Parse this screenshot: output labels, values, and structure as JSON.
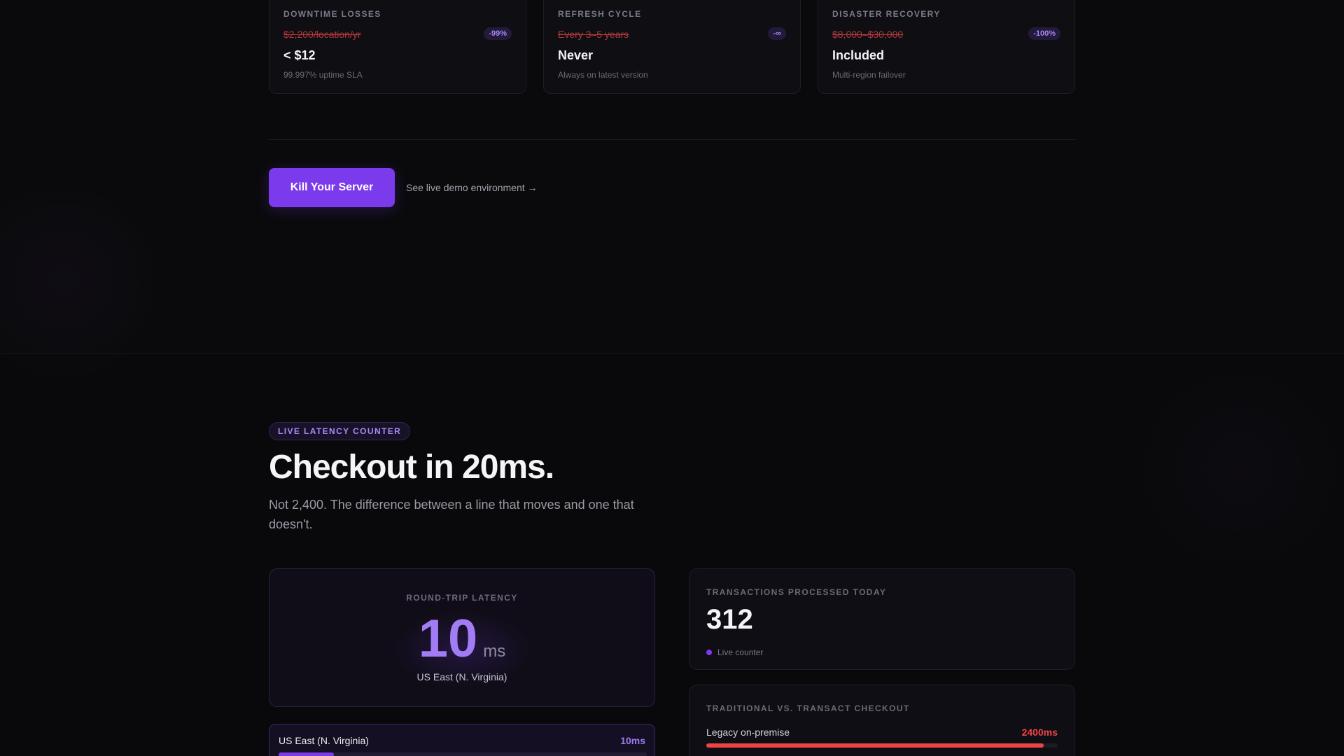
{
  "cost_cards": [
    {
      "label": "DOWNTIME LOSSES",
      "old": "$2,200/location/yr",
      "badge": "-99%",
      "new": "< $12",
      "note": "99.997% uptime SLA"
    },
    {
      "label": "REFRESH CYCLE",
      "old": "Every 3–5 years",
      "badge": "-∞",
      "new": "Never",
      "note": "Always on latest version"
    },
    {
      "label": "DISASTER RECOVERY",
      "old": "$8,000–$30,000",
      "badge": "-100%",
      "new": "Included",
      "note": "Multi-region failover"
    }
  ],
  "cta": {
    "button_label": "Kill Your Server",
    "link_label": "See live demo environment →"
  },
  "latency_section": {
    "pill": "LIVE LATENCY COUNTER",
    "heading": "Checkout in 20ms.",
    "subtitle": "Not 2,400. The difference between a line that moves and one that doesn't.",
    "latency_card": {
      "label": "ROUND-TRIP LATENCY",
      "value": "10",
      "unit": "ms",
      "region": "US East (N. Virginia)"
    },
    "region_rows": [
      {
        "name": "US East (N. Virginia)",
        "ms": "10ms",
        "fill_fraction": 0.15
      }
    ],
    "transactions": {
      "label": "TRANSACTIONS PROCESSED TODAY",
      "value": "312",
      "live_text": "Live counter"
    },
    "comparison": {
      "label": "TRADITIONAL VS. TRANSACT CHECKOUT",
      "rows": [
        {
          "name": "Legacy on-premise",
          "ms": "2400ms",
          "fill_fraction": 0.96
        }
      ]
    }
  },
  "colors": {
    "accent": "#7c3aed",
    "danger": "#ef4444",
    "background": "#09090b"
  }
}
